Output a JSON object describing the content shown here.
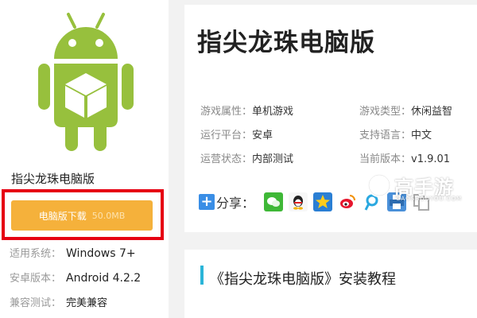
{
  "app": {
    "name": "指尖龙珠电脑版"
  },
  "download": {
    "label": "电脑版下载",
    "size": "50.0MB",
    "color": "#f5b13b",
    "highlight_color": "#e60012"
  },
  "specs": [
    {
      "label": "适用系统：",
      "value": "Windows 7+"
    },
    {
      "label": "安卓版本：",
      "value": "Android 4.2.2"
    },
    {
      "label": "兼容测试：",
      "value": "完美兼容"
    }
  ],
  "game": {
    "title": "指尖龙珠电脑版"
  },
  "info": [
    {
      "label": "游戏属性：",
      "value": "单机游戏"
    },
    {
      "label": "游戏类型：",
      "value": "休闲益智"
    },
    {
      "label": "运行平台：",
      "value": "安卓"
    },
    {
      "label": "支持语言：",
      "value": "中文"
    },
    {
      "label": "运营状态：",
      "value": "内部测试"
    },
    {
      "label": "当前版本：",
      "value": "v1.9.01"
    }
  ],
  "share": {
    "label": "分享：",
    "icons": [
      "wechat-icon",
      "qq-icon",
      "qzone-icon",
      "weibo-icon",
      "tencent-weibo-icon",
      "print-icon",
      "copy-icon"
    ]
  },
  "tutorial": {
    "title": "《指尖龙珠电脑版》安装教程",
    "accent": "#2bb5d8"
  },
  "watermark": {
    "brand": "高手游",
    "url": "GAOSHOUYOU.COM"
  }
}
